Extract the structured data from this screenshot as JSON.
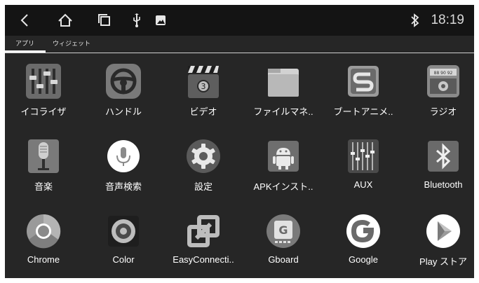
{
  "status_bar": {
    "time": "18:19",
    "icons": [
      "back-icon",
      "home-icon",
      "recents-icon",
      "usb-icon",
      "image-icon",
      "bluetooth-icon"
    ]
  },
  "tabs": [
    {
      "label": "アプリ",
      "active": true
    },
    {
      "label": "ウィジェット",
      "active": false
    }
  ],
  "apps": [
    {
      "label": "イコライザ",
      "icon": "equalizer-icon"
    },
    {
      "label": "ハンドル",
      "icon": "steering-wheel-icon"
    },
    {
      "label": "ビデオ",
      "icon": "video-clapper-icon"
    },
    {
      "label": "ファイルマネ..",
      "icon": "folder-icon"
    },
    {
      "label": "ブートアニメ..",
      "icon": "boot-animation-icon"
    },
    {
      "label": "ラジオ",
      "icon": "radio-icon"
    },
    {
      "label": "音楽",
      "icon": "microphone-icon"
    },
    {
      "label": "音声検索",
      "icon": "voice-search-icon"
    },
    {
      "label": "設定",
      "icon": "settings-gear-icon"
    },
    {
      "label": "APKインスト..",
      "icon": "apk-installer-icon"
    },
    {
      "label": "AUX",
      "icon": "aux-mixer-icon"
    },
    {
      "label": "Bluetooth",
      "icon": "bluetooth-app-icon"
    },
    {
      "label": "Chrome",
      "icon": "chrome-icon"
    },
    {
      "label": "Color",
      "icon": "color-icon"
    },
    {
      "label": "EasyConnecti..",
      "icon": "easyconnection-icon"
    },
    {
      "label": "Gboard",
      "icon": "gboard-icon"
    },
    {
      "label": "Google",
      "icon": "google-icon"
    },
    {
      "label": "Play ストア",
      "icon": "play-store-icon"
    }
  ]
}
